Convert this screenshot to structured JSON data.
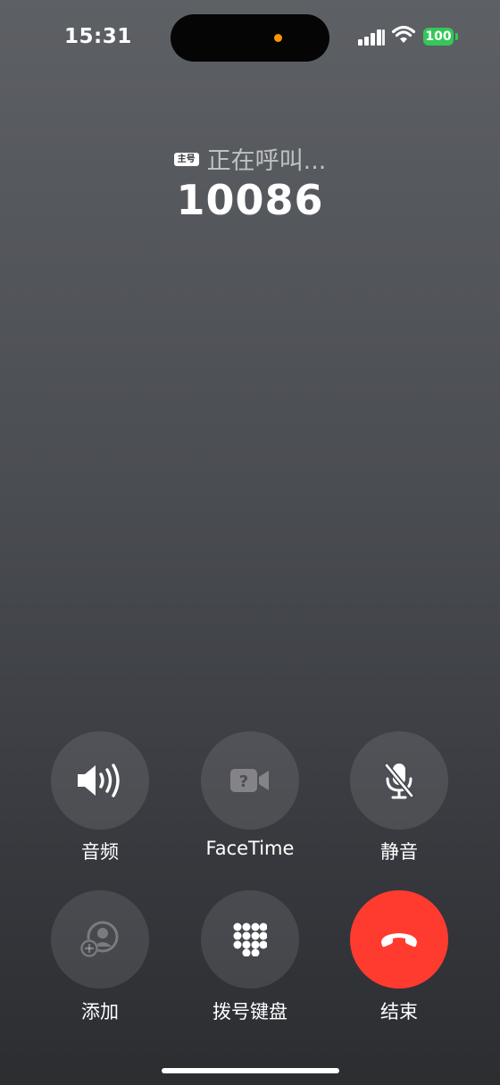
{
  "status_bar": {
    "time": "15:31",
    "battery_level": "100",
    "battery_color": "#34c759",
    "privacy_indicator_color": "#ff9500"
  },
  "call": {
    "sim_badge": "主号",
    "status": "正在呼叫...",
    "number": "10086"
  },
  "buttons": [
    {
      "label": "音频",
      "icon": "speaker-icon",
      "enabled": true
    },
    {
      "label": "FaceTime",
      "icon": "facetime-unavailable-icon",
      "enabled": false
    },
    {
      "label": "静音",
      "icon": "mute-icon",
      "enabled": true
    },
    {
      "label": "添加",
      "icon": "add-call-icon",
      "enabled": false
    },
    {
      "label": "拨号键盘",
      "icon": "keypad-icon",
      "enabled": true
    },
    {
      "label": "结束",
      "icon": "end-call-icon",
      "enabled": true,
      "color": "#ff3b30"
    }
  ]
}
